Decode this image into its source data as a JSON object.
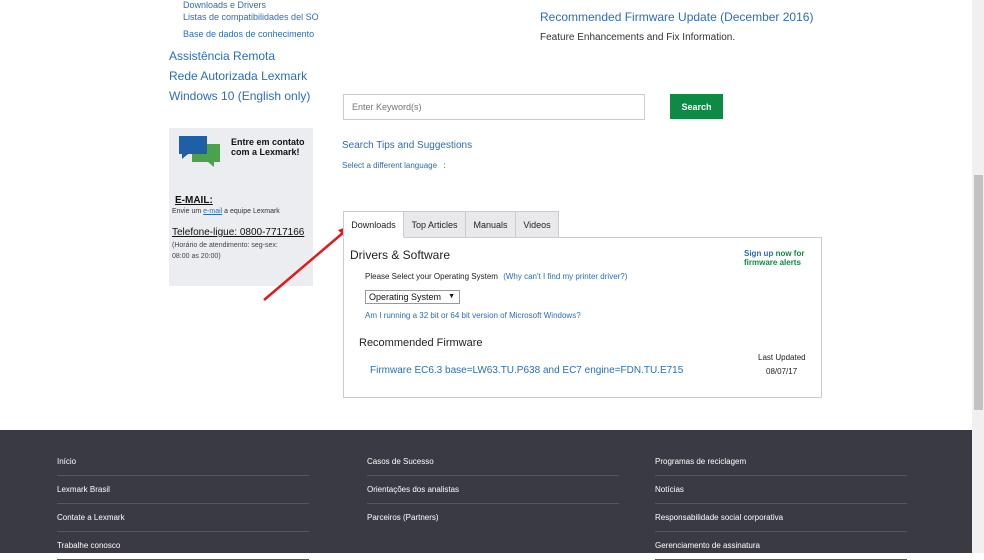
{
  "sidebar": {
    "sub_links": [
      "Downloads e Drivers",
      "Listas de compatibilidades del SO",
      "Base de dados de conhecimento"
    ],
    "links": [
      "Assistência Remota",
      "Rede Autorizada Lexmark",
      "Windows 10 (English only)"
    ],
    "contact": {
      "title": "Entre em contato com a Lexmark!",
      "email_heading": "E-MAIL:",
      "email_pre": "Envie um",
      "email_link": "e-mail",
      "email_post": "a equipe Lexmark",
      "phone": "Telefone-ligue: 0800-7717166",
      "hours": "(Horário de atendimento: seg-sex: 08:00 as 20:00)"
    }
  },
  "news": {
    "title": "Recommended Firmware Update (December 2016)",
    "desc": "Feature Enhancements and Fix Information."
  },
  "search": {
    "placeholder": "Enter Keyword(s)",
    "button": "Search",
    "tips": "Search Tips and Suggestions",
    "language": "Select a different language",
    "colon": ":"
  },
  "tabs": [
    "Downloads",
    "Top Articles",
    "Manuals",
    "Videos"
  ],
  "panel": {
    "title": "Drivers & Software",
    "signup_a": "Sign up",
    "signup_b": "now for firmware alerts",
    "select_label": "Please Select your Operating System",
    "why_link": "(Why can't I find my printer driver?)",
    "os_select": "Operating System",
    "bit_link": "Am I running a 32 bit or 64 bit version of Microsoft Windows?",
    "firmware_heading": "Recommended Firmware",
    "last_updated_label": "Last Updated",
    "firmware_link": "Firmware EC6.3 base=LW63.TU.P638 and EC7 engine=FDN.TU.E715",
    "last_updated": "08/07/17"
  },
  "footer": {
    "col1": [
      "Início",
      "Lexmark Brasil",
      "Contate a Lexmark",
      "Trabalhe conosco"
    ],
    "col2": [
      "Casos de Sucesso",
      "Orientações dos analistas",
      "Parceiros (Partners)"
    ],
    "col3": [
      "Programas de reciclagem",
      "Notícias",
      "Responsabilidade social corporativa",
      "Gerenciamento de assinatura"
    ]
  },
  "colors": {
    "link": "#2a6ebb",
    "search_button": "#0f8a44",
    "footer_bg": "#3a3a44",
    "annotation_arrow": "#e01b1b"
  }
}
